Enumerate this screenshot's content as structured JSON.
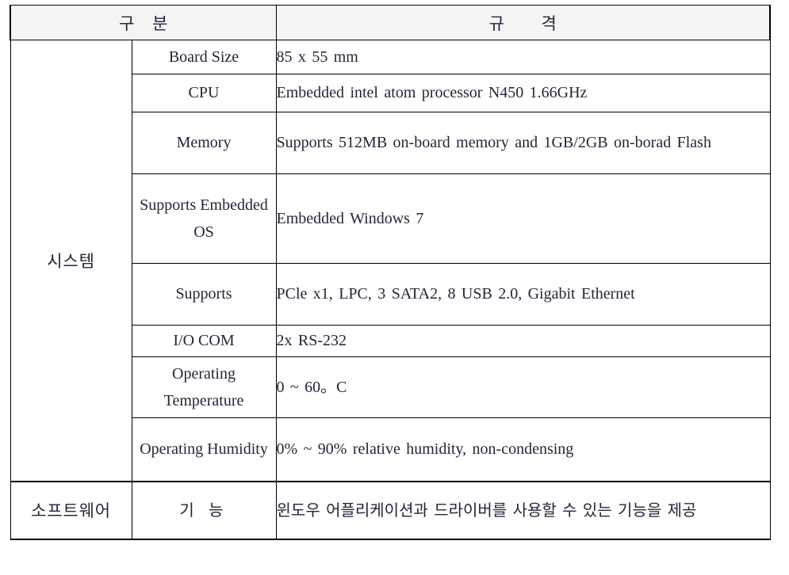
{
  "table": {
    "headers": {
      "col1": "구  분",
      "col2": "규    격"
    },
    "categories": [
      {
        "name": "시스템",
        "rowspan": 8
      },
      {
        "name": "소프트웨어",
        "rowspan": 1
      }
    ],
    "rows": [
      {
        "label": "Board Size",
        "value": "85 x 55 mm"
      },
      {
        "label": "CPU",
        "value": "Embedded intel atom processor N450 1.66GHz"
      },
      {
        "label": "Memory",
        "value": "Supports 512MB on-board memory and 1GB/2GB on-borad Flash"
      },
      {
        "label": "Supports Embedded OS",
        "value": "Embedded Windows 7"
      },
      {
        "label": "Supports",
        "value": "PCle x1, LPC, 3 SATA2, 8 USB 2.0, Gigabit Ethernet"
      },
      {
        "label": "I/O COM",
        "value": "2x RS-232"
      },
      {
        "label": "Operating Temperature",
        "value": "0 ~ 60。C"
      },
      {
        "label": "Operating Humidity",
        "value": "0% ~ 90% relative humidity, non-condensing"
      },
      {
        "label": "기  능",
        "value": "윈도우 어플리케이션과 드라이버를 사용할 수 있는 기능을 제공"
      }
    ]
  },
  "colors": {
    "header_background": "#f4f4f4",
    "border": "#000000",
    "text": "#25253a",
    "page_background": "#ffffff"
  }
}
